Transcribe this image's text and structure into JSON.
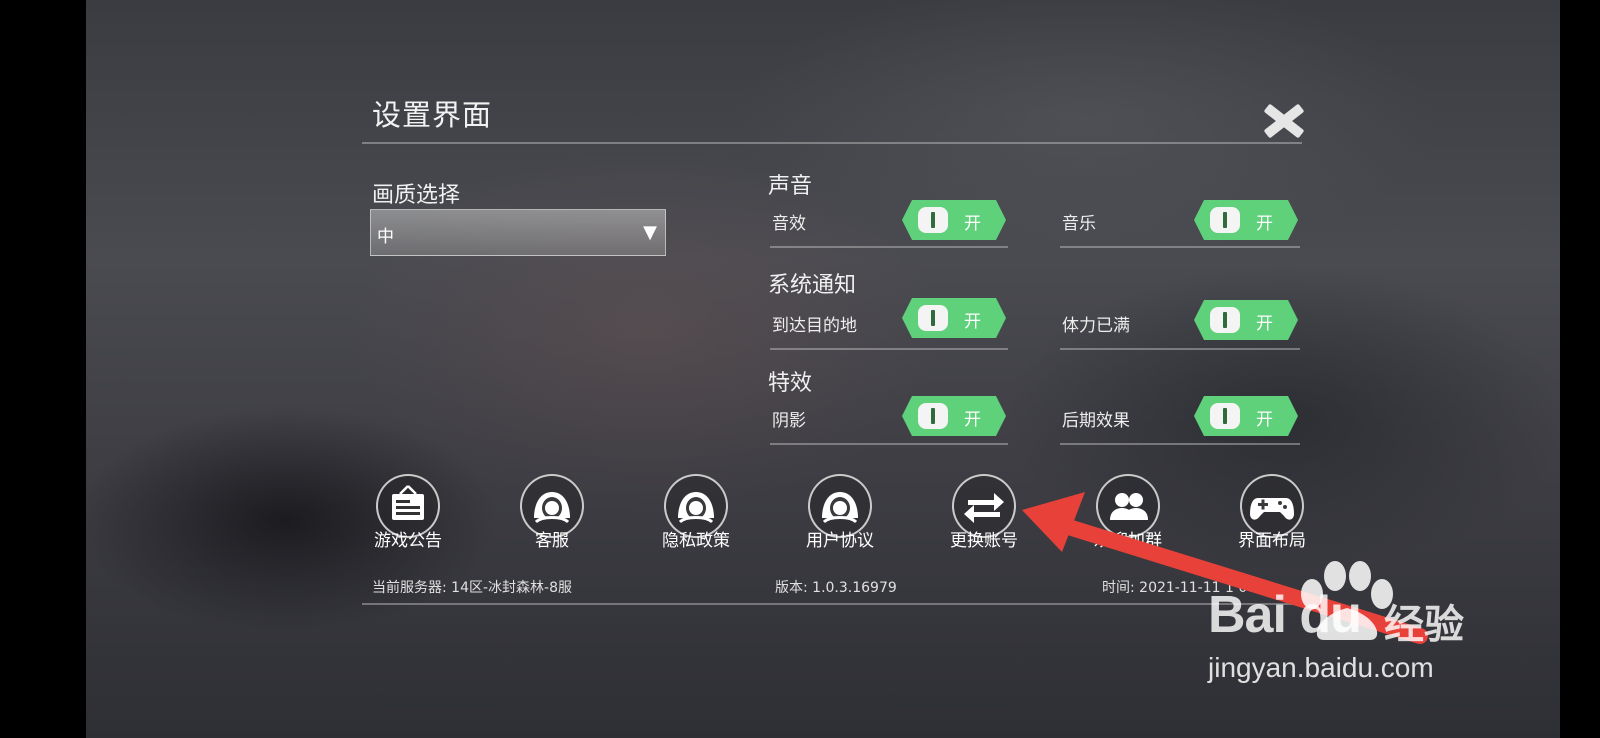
{
  "window": {
    "title": "设置界面"
  },
  "graphics": {
    "label": "画质选择",
    "selected": "中"
  },
  "sound": {
    "heading": "声音",
    "items": [
      {
        "label": "音效",
        "state": "开"
      },
      {
        "label": "音乐",
        "state": "开"
      }
    ]
  },
  "notify": {
    "heading": "系统通知",
    "items": [
      {
        "label": "到达目的地",
        "state": "开"
      },
      {
        "label": "体力已满",
        "state": "开"
      }
    ]
  },
  "effects": {
    "heading": "特效",
    "items": [
      {
        "label": "阴影",
        "state": "开"
      },
      {
        "label": "后期效果",
        "state": "开"
      }
    ]
  },
  "buttons": [
    {
      "label": "游戏公告",
      "icon": "notice-board-icon"
    },
    {
      "label": "客服",
      "icon": "customer-service-icon"
    },
    {
      "label": "隐私政策",
      "icon": "privacy-icon"
    },
    {
      "label": "用户协议",
      "icon": "agreement-icon"
    },
    {
      "label": "更换账号",
      "icon": "switch-account-icon"
    },
    {
      "label": "欢迎加群",
      "icon": "group-icon"
    },
    {
      "label": "界面布局",
      "icon": "gamepad-icon"
    }
  ],
  "footer": {
    "server": "当前服务器:  14区-冰封森林-8服",
    "version": "版本: 1.0.3.16979",
    "time": "时间: 2021-11-11 1    06"
  },
  "watermark": {
    "brand": "Bai  du",
    "brand_cn": "经验",
    "url": "jingyan.baidu.com"
  },
  "colors": {
    "toggle_on": "#2f6b3d",
    "toggle_edge": "#5fd17a",
    "annotation_arrow": "#e8413a"
  }
}
